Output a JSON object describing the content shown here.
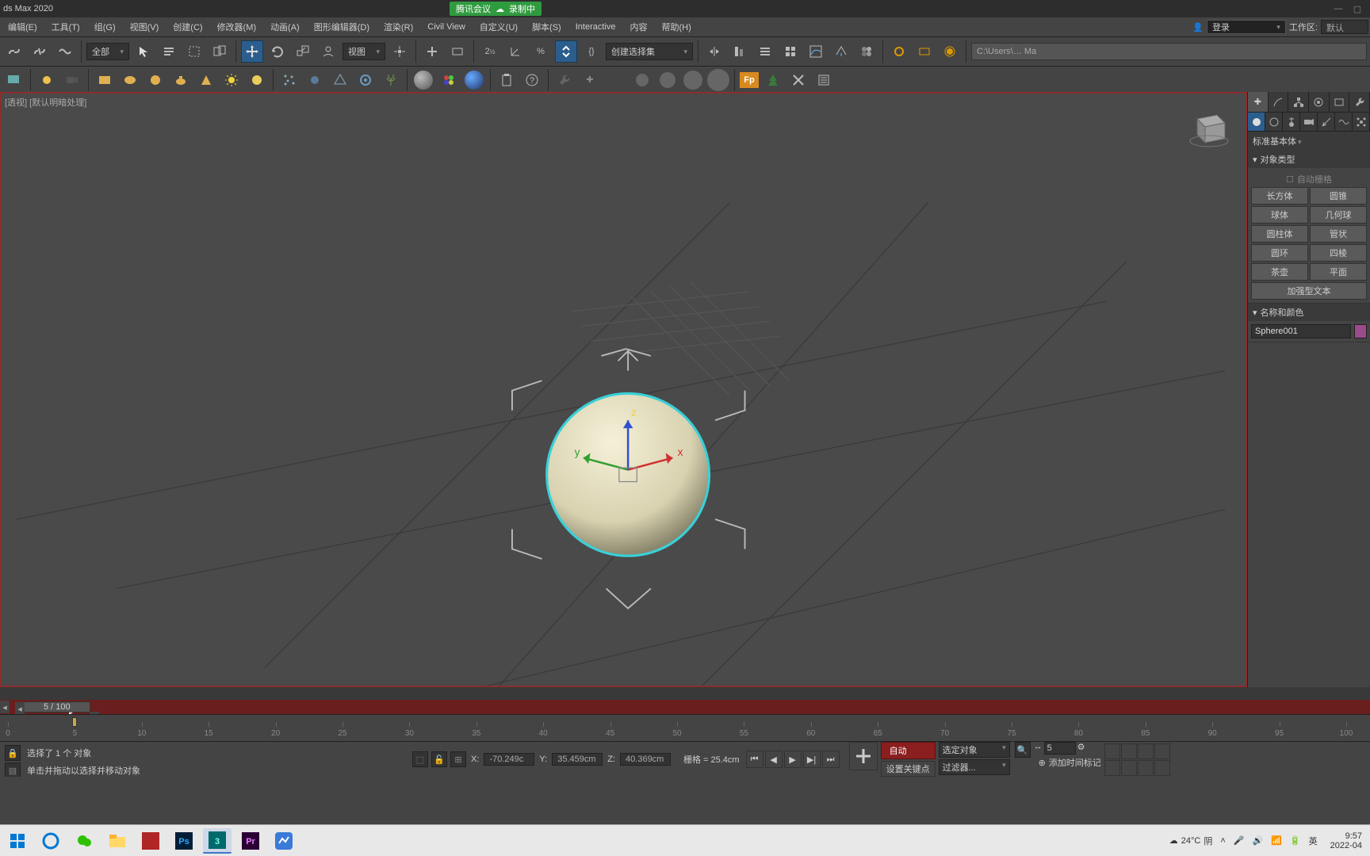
{
  "titlebar": {
    "app": "ds Max 2020",
    "tencent": "腾讯会议",
    "recording": "录制中"
  },
  "menu": {
    "items": [
      "编辑(E)",
      "工具(T)",
      "组(G)",
      "视图(V)",
      "创建(C)",
      "修改器(M)",
      "动画(A)",
      "图形编辑器(D)",
      "渲染(R)",
      "Civil View",
      "自定义(U)",
      "脚本(S)",
      "Interactive",
      "内容",
      "帮助(H)"
    ],
    "login": "登录",
    "workspace_label": "工作区:",
    "workspace_value": "默认"
  },
  "maintool": {
    "all": "全部",
    "view": "视图",
    "selset": "创建选择集",
    "path": "C:\\Users\\…  Ma"
  },
  "viewport": {
    "label": "[透视] [默认明暗处理]"
  },
  "cmdpanel": {
    "category": "标准基本体",
    "rollout_objtype": "对象类型",
    "autogrid": "自动栅格",
    "objbuttons": [
      "长方体",
      "圆锥",
      "球体",
      "几何球",
      "圆柱体",
      "管状",
      "圆环",
      "四棱",
      "茶壶",
      "平面",
      "加强型文本"
    ],
    "rollout_namecolor": "名称和颜色",
    "objname": "Sphere001"
  },
  "timeslider": {
    "label": "5 / 100"
  },
  "trackbar": {
    "ticks": [
      0,
      5,
      10,
      15,
      20,
      25,
      30,
      35,
      40,
      45,
      50,
      55,
      60,
      65,
      70,
      75,
      80,
      85,
      90,
      95,
      100
    ]
  },
  "status": {
    "selection": "选择了 1 个 对象",
    "hint": "单击并拖动以选择并移动对象",
    "x_label": "X:",
    "x": " -70.249c",
    "y_label": "Y:",
    "y": " 35.459cm",
    "z_label": "Z:",
    "z": " 40.369cm",
    "grid": "栅格 = 25.4cm",
    "addtag": "添加时间标记",
    "frame": "5",
    "autokey": "自动",
    "selobj": "选定对象",
    "setkey": "设置关键点",
    "filter": "过滤器..."
  },
  "taskbar": {
    "weather_temp": "24°C",
    "weather_cond": "阴",
    "time": "9:57",
    "date": "2022-04"
  }
}
